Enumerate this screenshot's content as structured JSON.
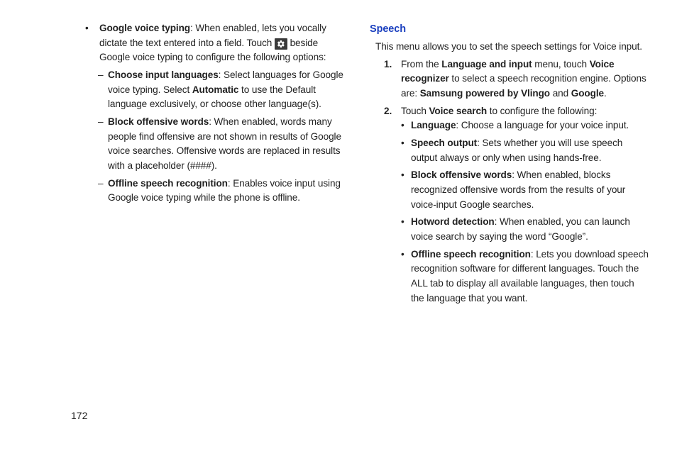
{
  "page_number": "172",
  "left_column": {
    "google_voice_typing": {
      "label": "Google voice typing",
      "text_before_icon": ": When enabled, lets you vocally dictate the text entered into a field. Touch ",
      "text_after_icon": " beside Google voice typing to configure the following options:"
    },
    "choose_input_languages": {
      "label": "Choose input languages",
      "text_before_auto": ": Select languages for Google voice typing. Select ",
      "automatic": "Automatic",
      "text_after_auto": " to use the Default language exclusively, or choose other language(s)."
    },
    "block_offensive_words": {
      "label": "Block offensive words",
      "text": ": When enabled, words many people find offensive are not shown in results of Google voice searches. Offensive words are replaced in results with a placeholder (####)."
    },
    "offline_speech_recognition": {
      "label": "Offline speech recognition",
      "text": ": Enables voice input using Google voice typing while the phone is offline."
    }
  },
  "right_column": {
    "heading": "Speech",
    "intro": "This menu allows you to set the speech settings for Voice input.",
    "step1": {
      "num": "1.",
      "a": "From the ",
      "lang_input": "Language and input",
      "b": " menu, touch ",
      "voice_rec": "Voice recognizer",
      "c": " to select a speech recognition engine. Options are: ",
      "samsung": "Samsung powered by Vlingo",
      "and": " and ",
      "google": "Google",
      "dot": "."
    },
    "step2": {
      "num": "2.",
      "a": "Touch ",
      "voice_search": "Voice search",
      "b": " to configure the following:"
    },
    "language": {
      "label": "Language",
      "text": ": Choose a language for your voice input."
    },
    "speech_output": {
      "label": "Speech output",
      "text": ": Sets whether you will use speech output always or only when using hands-free."
    },
    "block_offensive_words": {
      "label": "Block offensive words",
      "text": ": When enabled, blocks recognized offensive words from the results of your voice-input Google searches."
    },
    "hotword_detection": {
      "label": "Hotword detection",
      "text": ": When enabled, you can launch voice search by saying the word “Google”."
    },
    "offline_speech_recognition": {
      "label": "Offline speech recognition",
      "text": ": Lets you download speech recognition software for different languages. Touch the ALL tab to display all available languages, then touch the language that you want."
    }
  }
}
